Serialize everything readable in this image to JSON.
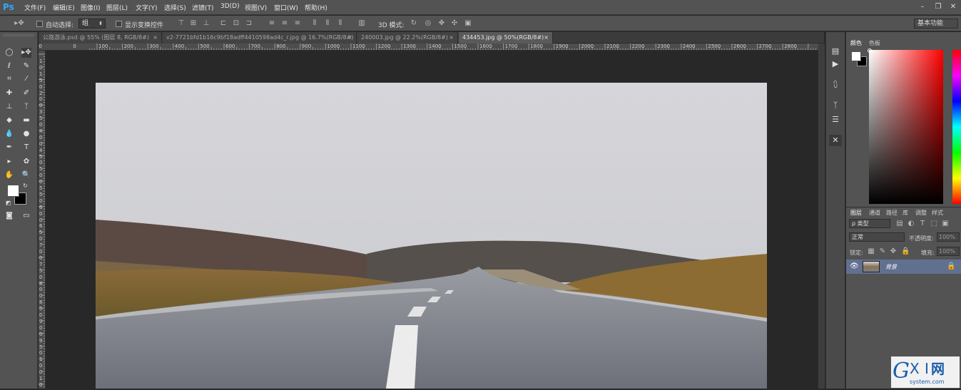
{
  "app": {
    "logo": "Ps"
  },
  "menu": [
    "文件(F)",
    "编辑(E)",
    "图像(I)",
    "图层(L)",
    "文字(Y)",
    "选择(S)",
    "滤镜(T)",
    "3D(D)",
    "视图(V)",
    "窗口(W)",
    "帮助(H)"
  ],
  "window_controls": {
    "minimize": "–",
    "restore": "❐",
    "close": "✕"
  },
  "options": {
    "auto_select_label": "自动选择:",
    "auto_select_value": "组",
    "show_transform_label": "显示变换控件",
    "mode_3d_label": "3D 模式:",
    "workspace": "基本功能"
  },
  "tabs": [
    {
      "label": "公路游泳.psd @ 55% (图层 8, RGB/8#)",
      "close": "×",
      "active": false
    },
    {
      "label": "v2-7721bfd1b16c9bf18adff4410598ad4c_r.jpg @ 16.7%(RGB/8#)",
      "close": "×",
      "active": false
    },
    {
      "label": "240003.jpg @ 22.2%(RGB/8#)",
      "close": "×",
      "active": false
    },
    {
      "label": "434453.jpg @ 50%(RGB/8#)",
      "close": "×",
      "active": true
    }
  ],
  "ruler": {
    "h_labels": [
      "200",
      "0",
      "100",
      "200",
      "300",
      "400",
      "500",
      "600",
      "700",
      "800",
      "900",
      "1000",
      "1100",
      "1200",
      "1300",
      "1400",
      "1500",
      "1600",
      "1700",
      "1800",
      "1900",
      "2000",
      "2100",
      "2200",
      "2300",
      "2400",
      "2500",
      "2600",
      "2700",
      "2800"
    ],
    "v_labels": [
      "1",
      "0",
      "1",
      "5",
      "0",
      "2",
      "0",
      "0",
      "3",
      "5",
      "0",
      "4",
      "0",
      "0",
      "4",
      "5",
      "0",
      "5",
      "0",
      "0",
      "5",
      "5",
      "0",
      "6",
      "0",
      "0",
      "6",
      "5",
      "0",
      "7",
      "0",
      "0",
      "7",
      "5",
      "0",
      "8",
      "0",
      "0",
      "8",
      "5",
      "0",
      "9",
      "0",
      "0",
      "9",
      "5",
      "0",
      "1",
      "0",
      "0",
      "1",
      "0",
      "5"
    ]
  },
  "panels": {
    "color_tabs": [
      "颜色",
      "色板"
    ],
    "layer_tabs": [
      "图层",
      "通道",
      "路径",
      "库",
      "调整",
      "样式"
    ],
    "kind_filter": "ρ 类型",
    "blend_mode": "正常",
    "opacity_label": "不透明度:",
    "opacity_value": "100%",
    "lock_label": "锁定:",
    "fill_label": "填充:",
    "fill_value": "100%",
    "layer_name": "背景"
  },
  "colors": {
    "accent": "#31a8ff",
    "foreground": "#ffffff",
    "background": "#000000"
  },
  "icons": [
    "move-tool-icon",
    "marquee-tool-icon",
    "lasso-tool-icon",
    "crop-tool-icon",
    "eyedropper-tool-icon",
    "brush-tool-icon",
    "stamp-tool-icon",
    "eraser-tool-icon",
    "gradient-tool-icon",
    "blur-tool-icon",
    "dodge-tool-icon",
    "pen-tool-icon",
    "type-tool-icon",
    "path-select-icon",
    "shape-tool-icon",
    "hand-tool-icon",
    "zoom-tool-icon",
    "eye-icon",
    "lock-icon"
  ]
}
